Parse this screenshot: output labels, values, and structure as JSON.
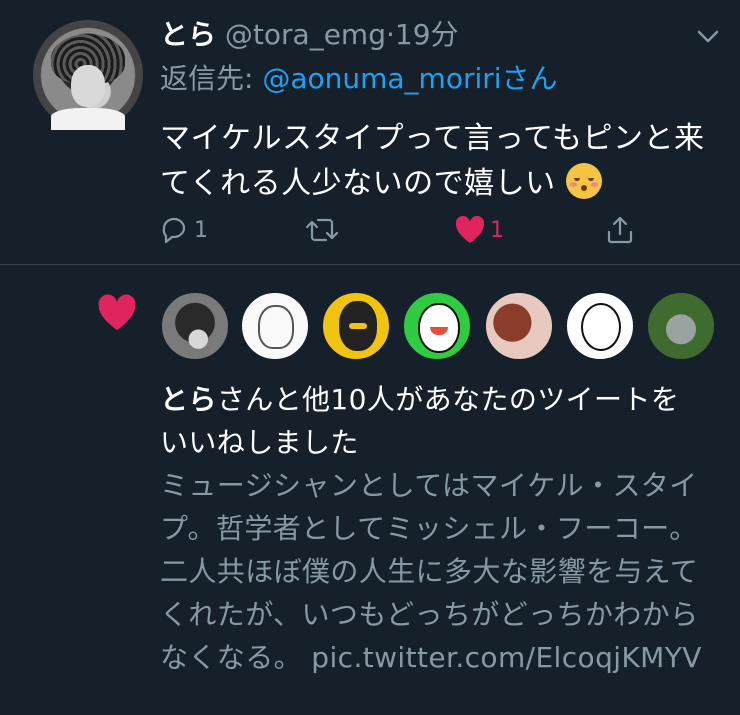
{
  "tweet": {
    "display_name": "とら",
    "handle": "@tora_emg",
    "separator": "·",
    "time": "19分",
    "reply_prefix": "返信先: ",
    "reply_to": "@aonuma_moririさん",
    "text": "マイケルスタイプって言ってもピンと来てくれる人少ないので嬉しい",
    "emoji": "kissing-smiling-eyes-emoji",
    "reply_count": "1",
    "retweet_count": "",
    "like_count": "1",
    "icons": [
      "chevron-down-icon",
      "reply-icon",
      "retweet-icon",
      "heart-icon",
      "share-icon"
    ]
  },
  "notification": {
    "icon": "heart-icon",
    "liker_avatars": [
      "avatar-1",
      "avatar-2",
      "avatar-3",
      "avatar-4",
      "avatar-5",
      "avatar-6",
      "avatar-7"
    ],
    "name": "とら",
    "summary": "さんと他10人があなたのツイートをいいねしました",
    "liked_tweet_text": "ミュージシャンとしてはマイケル・スタイプ。哲学者としてミッシェル・フーコー。二人共ほぼ僕の人生に多大な影響を与えてくれたが、いつもどっちがどっちかわからなくなる。 pic.twitter.com/ElcoqjKMYV"
  },
  "colors": {
    "background": "#15202b",
    "text": "#ffffff",
    "muted": "#8899a6",
    "link": "#1da1f2",
    "like": "#e0245e",
    "divider": "#38444d"
  }
}
